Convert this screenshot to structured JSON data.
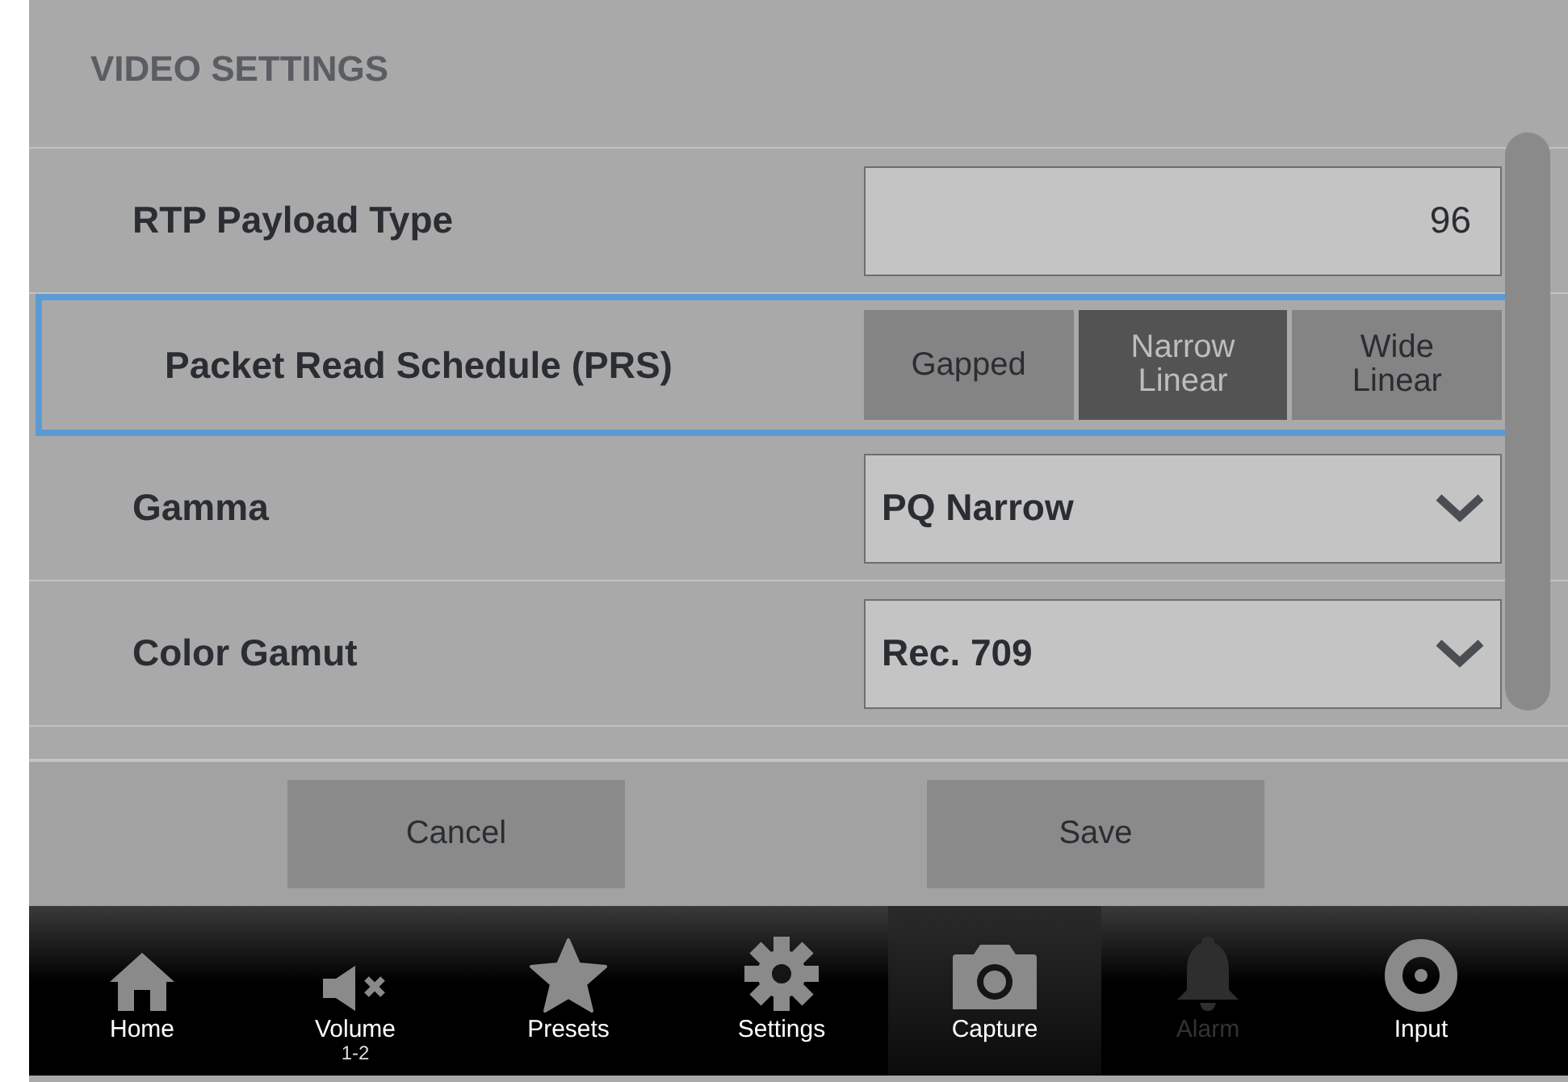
{
  "header": {
    "title": "VIDEO SETTINGS"
  },
  "settings": [
    {
      "kind": "number",
      "label": "RTP Payload Type",
      "value": "96",
      "focused": false
    },
    {
      "kind": "segmented",
      "label": "Packet Read Schedule (PRS)",
      "focused": true,
      "options": [
        {
          "label": "Gapped",
          "selected": false
        },
        {
          "label": "Narrow Linear",
          "selected": true
        },
        {
          "label": "Wide Linear",
          "selected": false
        }
      ]
    },
    {
      "kind": "dropdown",
      "label": "Gamma",
      "value": "PQ Narrow",
      "focused": false
    },
    {
      "kind": "dropdown",
      "label": "Color Gamut",
      "value": "Rec. 709",
      "focused": false
    }
  ],
  "actions": [
    {
      "label": "Cancel"
    },
    {
      "label": "Save"
    }
  ],
  "nav": [
    {
      "kind": "home",
      "label": "Home",
      "disabled": false,
      "selected": false
    },
    {
      "kind": "volume",
      "label": "Volume",
      "sublabel": "1-2",
      "disabled": false,
      "selected": false
    },
    {
      "kind": "star",
      "label": "Presets",
      "disabled": false,
      "selected": false
    },
    {
      "kind": "gear",
      "label": "Settings",
      "disabled": false,
      "selected": false
    },
    {
      "kind": "camera",
      "label": "Capture",
      "disabled": false,
      "selected": true
    },
    {
      "kind": "bell",
      "label": "Alarm",
      "disabled": true,
      "selected": false
    },
    {
      "kind": "target",
      "label": "Input",
      "disabled": false,
      "selected": false
    }
  ]
}
